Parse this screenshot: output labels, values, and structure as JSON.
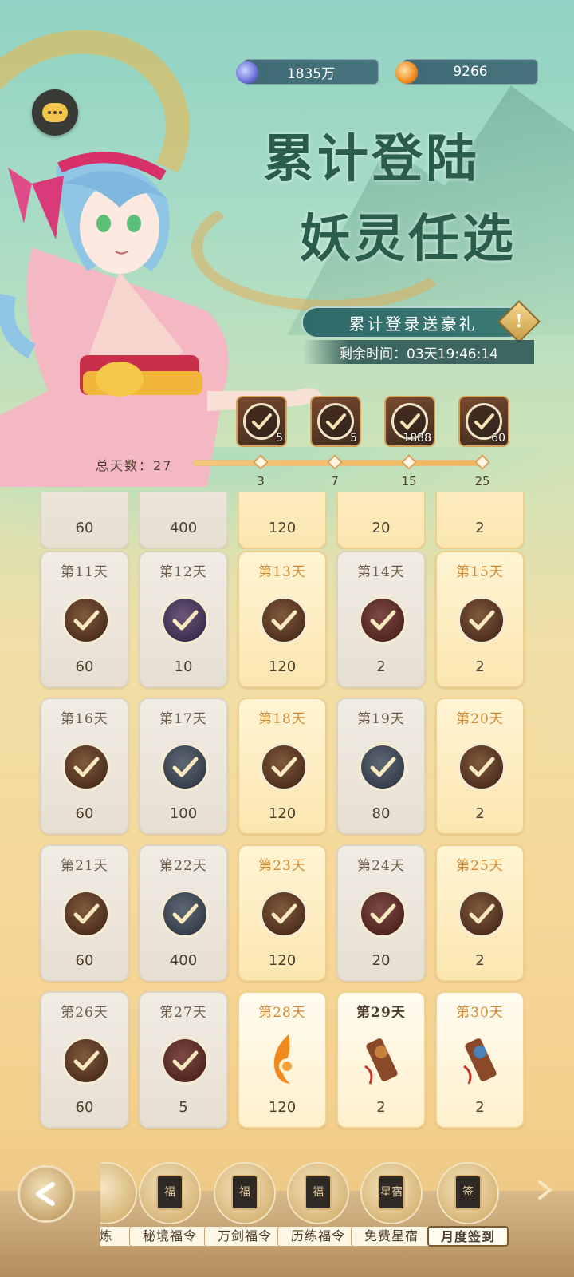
{
  "currency": [
    {
      "icon": "spirit-jade-icon",
      "value": "1835万"
    },
    {
      "icon": "flame-coin-icon",
      "value": "9266"
    }
  ],
  "title": {
    "line1": "累计登陆",
    "line2": "妖灵任选"
  },
  "banner": "累计登录送豪礼",
  "timer": "剩余时间：03天19:46:14",
  "milestones": {
    "total_label": "总天数：",
    "total_days": "27",
    "progress": 1.0,
    "rewards": [
      {
        "qty": "5",
        "claimed": true
      },
      {
        "qty": "5",
        "claimed": true
      },
      {
        "qty": "1888",
        "claimed": true
      },
      {
        "qty": "60",
        "claimed": true
      }
    ],
    "nodes": [
      "3",
      "7",
      "15",
      "25"
    ]
  },
  "partial_row": [
    "60",
    "400",
    "120",
    "20",
    "2"
  ],
  "days": [
    {
      "label": "第11天",
      "qty": "60",
      "style": "grey",
      "item": "brown",
      "claimed": true
    },
    {
      "label": "第12天",
      "qty": "10",
      "style": "grey",
      "item": "purple",
      "claimed": true
    },
    {
      "label": "第13天",
      "qty": "120",
      "style": "gold",
      "item": "brown",
      "claimed": true
    },
    {
      "label": "第14天",
      "qty": "2",
      "style": "grey",
      "item": "red",
      "claimed": true
    },
    {
      "label": "第15天",
      "qty": "2",
      "style": "gold",
      "item": "brown",
      "claimed": true
    },
    {
      "label": "第16天",
      "qty": "60",
      "style": "grey",
      "item": "brown",
      "claimed": true
    },
    {
      "label": "第17天",
      "qty": "100",
      "style": "grey",
      "item": "blue",
      "claimed": true
    },
    {
      "label": "第18天",
      "qty": "120",
      "style": "gold",
      "item": "brown",
      "claimed": true
    },
    {
      "label": "第19天",
      "qty": "80",
      "style": "grey",
      "item": "blue",
      "claimed": true
    },
    {
      "label": "第20天",
      "qty": "2",
      "style": "gold",
      "item": "brown",
      "claimed": true
    },
    {
      "label": "第21天",
      "qty": "60",
      "style": "grey",
      "item": "brown",
      "claimed": true
    },
    {
      "label": "第22天",
      "qty": "400",
      "style": "grey",
      "item": "blue",
      "claimed": true
    },
    {
      "label": "第23天",
      "qty": "120",
      "style": "gold",
      "item": "brown",
      "claimed": true
    },
    {
      "label": "第24天",
      "qty": "20",
      "style": "grey",
      "item": "red",
      "claimed": true
    },
    {
      "label": "第25天",
      "qty": "2",
      "style": "gold",
      "item": "brown",
      "claimed": true
    },
    {
      "label": "第26天",
      "qty": "60",
      "style": "grey",
      "item": "brown",
      "claimed": true
    },
    {
      "label": "第27天",
      "qty": "5",
      "style": "grey",
      "item": "red",
      "claimed": true
    },
    {
      "label": "第28天",
      "qty": "120",
      "style": "active",
      "item": "flame",
      "claimed": false
    },
    {
      "label": "第29天",
      "qty": "2",
      "style": "active-plain",
      "item": "charm",
      "claimed": false
    },
    {
      "label": "第30天",
      "qty": "2",
      "style": "active",
      "item": "charm-blue",
      "claimed": false
    }
  ],
  "tabs": [
    {
      "label": "炼",
      "badge": ""
    },
    {
      "label": "秘境福令",
      "badge": "福"
    },
    {
      "label": "万剑福令",
      "badge": "福"
    },
    {
      "label": "历练福令",
      "badge": "福"
    },
    {
      "label": "免费星宿",
      "badge": "星宿"
    },
    {
      "label": "月度签到",
      "badge": "签"
    }
  ]
}
